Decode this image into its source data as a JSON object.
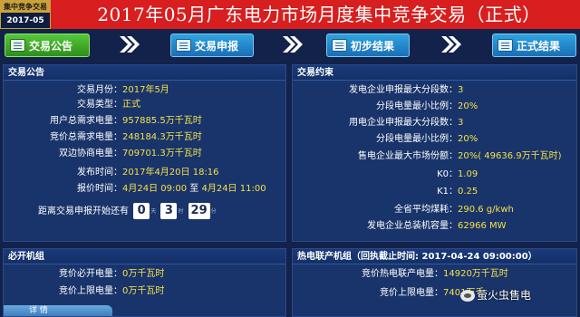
{
  "badge": {
    "top": "集中竞争交易",
    "bottom": "2017-05"
  },
  "title": "2017年05月广东电力市场月度集中竞争交易（正式）",
  "steps": [
    {
      "label": "交易公告",
      "state": "active"
    },
    {
      "label": "交易申报",
      "state": "idle"
    },
    {
      "label": "初步结果",
      "state": "idle"
    },
    {
      "label": "正式结果",
      "state": "idle"
    }
  ],
  "announcement": {
    "title": "交易公告",
    "rows": [
      {
        "label": "交易月份：",
        "value": "2017年5月"
      },
      {
        "label": "交易类型：",
        "value": "正式"
      },
      {
        "label": "用户总需求电量：",
        "value": "957885.5万千瓦时"
      },
      {
        "label": "竞价总需求电量：",
        "value": "248184.3万千瓦时"
      },
      {
        "label": "双边协商电量：",
        "value": "709701.3万千瓦时"
      },
      {
        "label": "发布时间：",
        "value": "2017年4月20日 18:16"
      },
      {
        "label": "报价时间：",
        "value_a": "4月24日 09:00",
        "mid": "至",
        "value_b": "4月24日 11:00"
      }
    ],
    "countdown": {
      "label": "距离交易申报开始还有",
      "days": "0",
      "days_unit": "天",
      "hours": "3",
      "hours_unit": "时",
      "minutes": "29",
      "minutes_unit": "分"
    }
  },
  "constraints": {
    "title": "交易约束",
    "rows": [
      {
        "label": "发电企业申报最大分段数：",
        "value": "3"
      },
      {
        "label": "分段电量最小比例：",
        "value": "20%"
      },
      {
        "label": "用电企业申报最大分段数：",
        "value": "3"
      },
      {
        "label": "分段电量最小比例：",
        "value": "20%"
      },
      {
        "label": "售电企业最大市场份额：",
        "value": "20%( 49636.9万千瓦时)"
      },
      {
        "label": "K0：",
        "value": "1.09"
      },
      {
        "label": "K1：",
        "value": "0.25"
      },
      {
        "label": "全省平均煤耗：",
        "value": "290.6 g/kwh"
      },
      {
        "label": "发电企业总装机容量：",
        "value": "62966 MW"
      }
    ]
  },
  "must_run": {
    "title": "必开机组",
    "rows": [
      {
        "label": "竞价必开电量：",
        "value": "0万千瓦时"
      },
      {
        "label": "竞价上限电量：",
        "value": "0万千瓦时"
      }
    ],
    "detail": "详 情"
  },
  "chp": {
    "title": "热电联产机组（回执截止时间: 2017-04-24 09:00:00）",
    "rows": [
      {
        "label": "竞价热电联产电量：",
        "value": "14920万千瓦时"
      },
      {
        "label": "竞价上限电量：",
        "value": "7401万千"
      }
    ]
  },
  "watermark": "萤火虫售电",
  "colors": {
    "header_red": "#d81e1e",
    "panel_bg": "#19346a",
    "value_yellow": "#f5e04a",
    "active_green": "#3fae28",
    "step_blue": "#2186cc"
  }
}
